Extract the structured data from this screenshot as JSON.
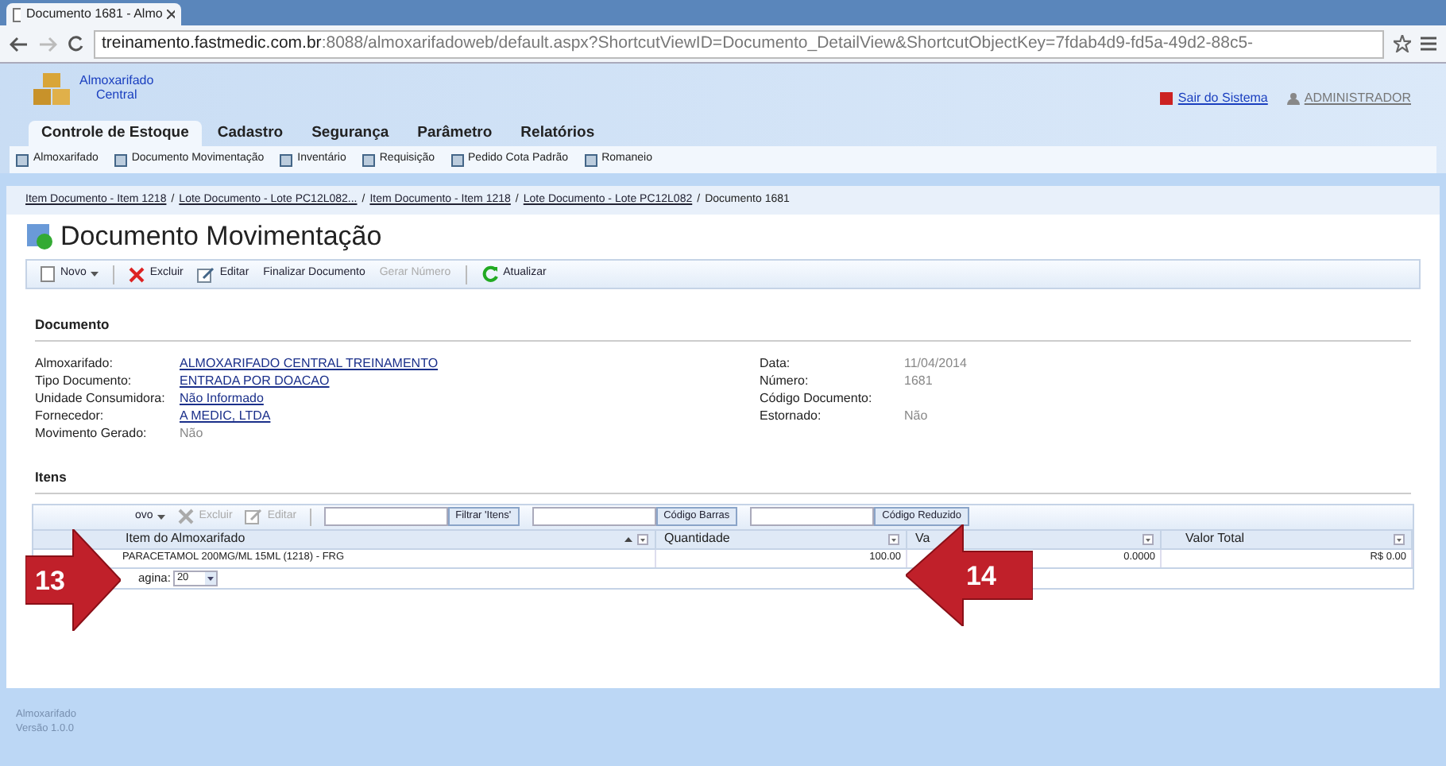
{
  "browser": {
    "tab_title": "Documento 1681 - Almo",
    "url_host": "treinamento.fastmedic.com.br",
    "url_rest": ":8088/almoxarifadoweb/default.aspx?ShortcutViewID=Documento_DetailView&ShortcutObjectKey=7fdab4d9-fd5a-49d2-88c5-"
  },
  "header": {
    "logo_lines": [
      "Almoxarifado",
      "Central"
    ],
    "links": [
      "Sair do Sistema",
      "ADMINISTRADOR"
    ]
  },
  "tabs": [
    {
      "label": "Controle de Estoque",
      "selected": true
    },
    {
      "label": "Cadastro",
      "selected": false
    },
    {
      "label": "Segurança",
      "selected": false
    },
    {
      "label": "Parâmetro",
      "selected": false
    },
    {
      "label": "Relatórios",
      "selected": false
    }
  ],
  "nav_items": [
    "Almoxarifado",
    "Documento Movimentação",
    "Inventário",
    "Requisição",
    "Pedido Cota Padrão",
    "Romaneio"
  ],
  "breadcrumbs": [
    {
      "label": "Item Documento - Item 1218",
      "kind": "link"
    },
    {
      "label": "/",
      "kind": "separator"
    },
    {
      "label": "Lote Documento - Lote PC12L082...",
      "kind": "link"
    },
    {
      "label": "/",
      "kind": "separator"
    },
    {
      "label": "Item Documento - Item 1218",
      "kind": "link"
    },
    {
      "label": "/",
      "kind": "separator"
    },
    {
      "label": "Lote Documento - Lote PC12L082",
      "kind": "link"
    },
    {
      "label": "/",
      "kind": "separator"
    },
    {
      "label": "Documento 1681",
      "kind": "current"
    }
  ],
  "page_title": "Documento Movimentação",
  "toolbar": [
    {
      "label": "Novo",
      "kind": "new",
      "disabled": false
    },
    {
      "label": "Excluir",
      "kind": "delete",
      "disabled": false
    },
    {
      "label": "Editar",
      "kind": "edit",
      "disabled": false
    },
    {
      "label": "Finalizar Documento",
      "kind": "text",
      "disabled": false
    },
    {
      "label": "Gerar Número",
      "kind": "text",
      "disabled": true
    },
    {
      "label": "Atualizar",
      "kind": "refresh",
      "disabled": false
    }
  ],
  "document": {
    "title": "Documento",
    "left_fields": [
      {
        "label": "Almoxarifado:",
        "value": "ALMOXARIFADO CENTRAL TREINAMENTO",
        "kind": "link"
      },
      {
        "label": "Tipo Documento:",
        "value": "ENTRADA POR DOACAO",
        "kind": "link"
      },
      {
        "label": "Unidade Consumidora:",
        "value": "Não Informado",
        "kind": "link"
      },
      {
        "label": "Fornecedor:",
        "value": "A MEDIC, LTDA",
        "kind": "link"
      },
      {
        "label": "Movimento Gerado:",
        "value": "Não",
        "kind": "plain"
      }
    ],
    "right_fields": [
      {
        "label": "Data:",
        "value": "11/04/2014",
        "kind": "plain"
      },
      {
        "label": "Número:",
        "value": "1681",
        "kind": "plain"
      },
      {
        "label": "Código Documento:"
      },
      {
        "label": "Estornado:",
        "value": "Não",
        "kind": "plain"
      }
    ]
  },
  "items": {
    "title": "Itens",
    "toolbar": [
      {
        "label": "ovo",
        "kind": "new",
        "disabled": false
      },
      {
        "label": "Excluir",
        "kind": "delete",
        "disabled": true
      },
      {
        "label": "Editar",
        "kind": "edit",
        "disabled": true
      }
    ],
    "filters": [
      "Filtrar 'Itens'",
      "Código Barras",
      "Código Reduzido"
    ],
    "columns": [
      {
        "label": "Item do Almoxarifado",
        "sorted": true
      },
      {
        "label": "Quantidade",
        "sorted": false
      },
      {
        "label": "Va",
        "sorted": false
      },
      {
        "label": "Valor Total",
        "sorted": false
      }
    ],
    "rows": [
      [
        "PARACETAMOL 200MG/ML 15ML (1218) - FRG",
        "100.00",
        "0.0000",
        "R$ 0.00"
      ]
    ],
    "pager_label": "agina:",
    "page_size": "20"
  },
  "footer": [
    "Almoxarifado",
    "Versão 1.0.0"
  ],
  "callouts": [
    {
      "number": "13",
      "kind": "right"
    },
    {
      "number": "14",
      "kind": "left"
    }
  ]
}
